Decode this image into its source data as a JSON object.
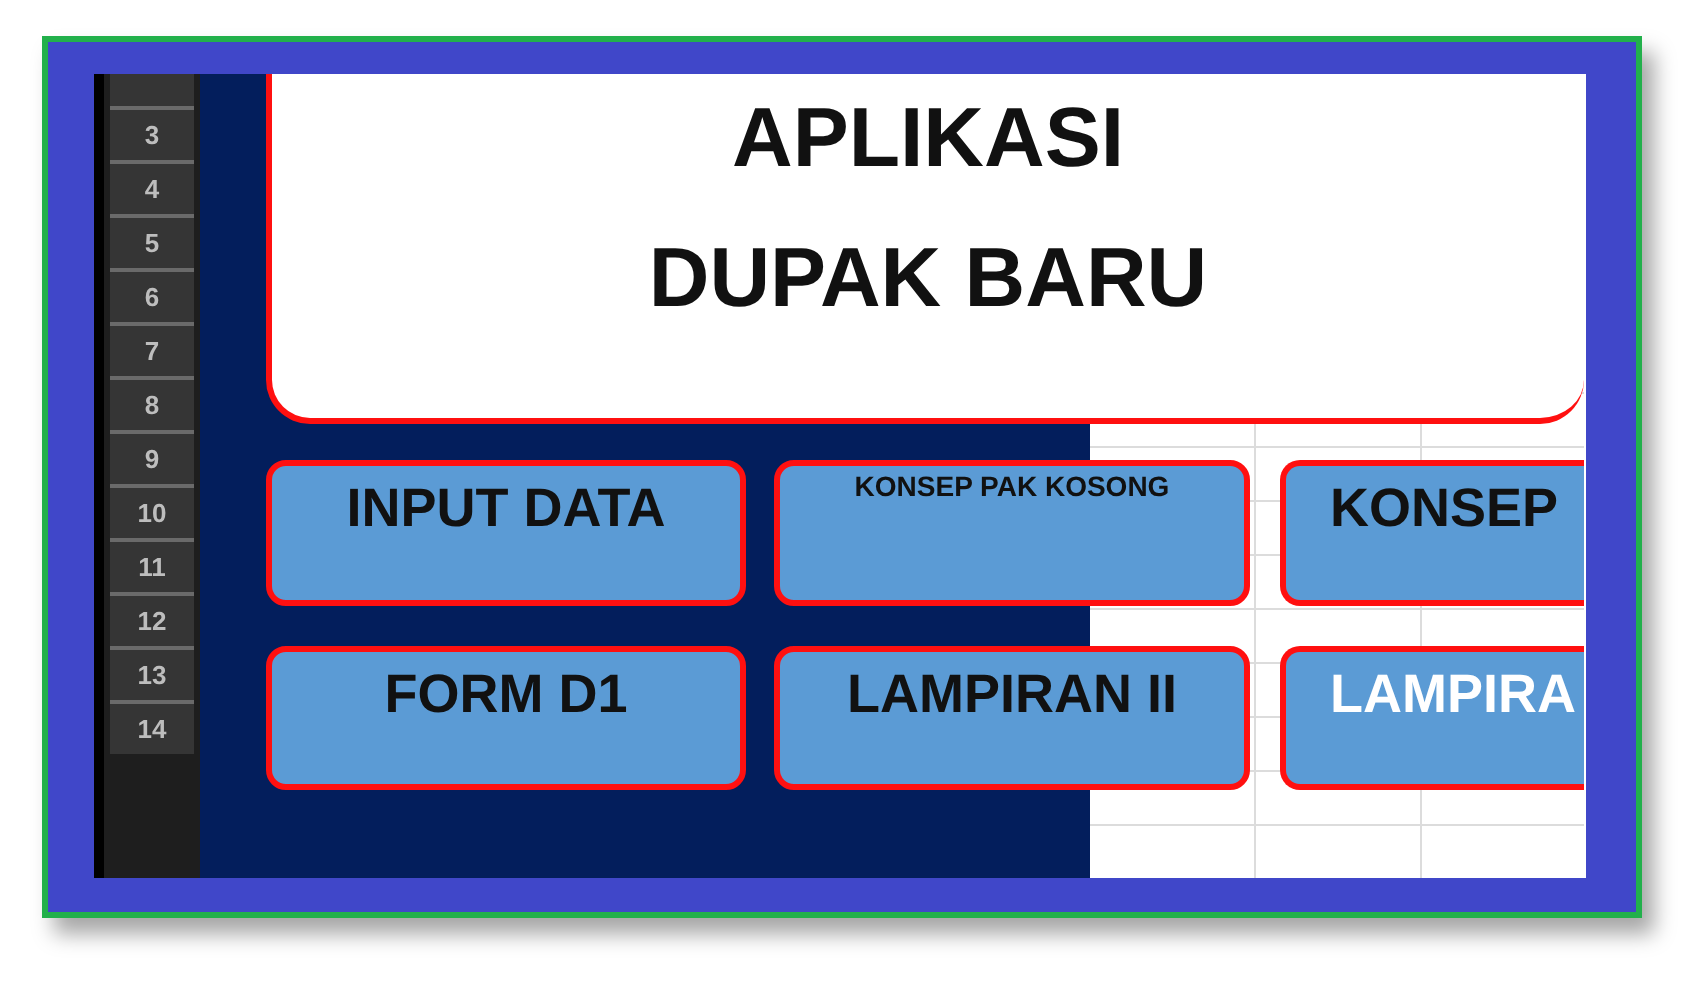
{
  "row_numbers": [
    "3",
    "4",
    "5",
    "6",
    "7",
    "8",
    "9",
    "10",
    "11",
    "12",
    "13",
    "14"
  ],
  "title": {
    "lines": [
      "APLIKASI",
      "DUPAK BARU"
    ]
  },
  "buttons": [
    {
      "label": "INPUT DATA",
      "kind": "standard"
    },
    {
      "label": "KONSEP PAK KOSONG",
      "kind": "small"
    },
    {
      "label": "KONSEP",
      "kind": "standard"
    },
    {
      "label": "FORM D1",
      "kind": "standard"
    },
    {
      "label": "LAMPIRAN II",
      "kind": "standard"
    },
    {
      "label": "LAMPIRA",
      "kind": "inverse"
    }
  ]
}
